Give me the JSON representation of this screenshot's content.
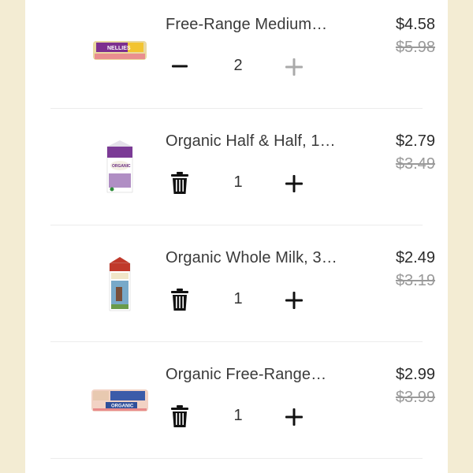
{
  "cart_items": [
    {
      "name": "Free-Range Medium…",
      "price": "$4.58",
      "original_price": "$5.98",
      "quantity": "2",
      "left_control_icon": "minus-icon",
      "plus_disabled": true,
      "image": "egg-carton-nellies"
    },
    {
      "name": "Organic Half & Half, 1…",
      "price": "$2.79",
      "original_price": "$3.49",
      "quantity": "1",
      "left_control_icon": "trash-icon",
      "plus_disabled": false,
      "image": "half-and-half-carton"
    },
    {
      "name": "Organic Whole Milk, 3…",
      "price": "$2.49",
      "original_price": "$3.19",
      "quantity": "1",
      "left_control_icon": "trash-icon",
      "plus_disabled": false,
      "image": "whole-milk-carton"
    },
    {
      "name": "Organic Free-Range…",
      "price": "$2.99",
      "original_price": "$3.99",
      "quantity": "1",
      "left_control_icon": "trash-icon",
      "plus_disabled": false,
      "image": "egg-carton-organic"
    }
  ],
  "colors": {
    "background": "#f3ecd3",
    "panel": "#ffffff",
    "text": "#333333",
    "strike_price": "#9a9a9a",
    "disabled_icon": "#aaaaaa"
  }
}
